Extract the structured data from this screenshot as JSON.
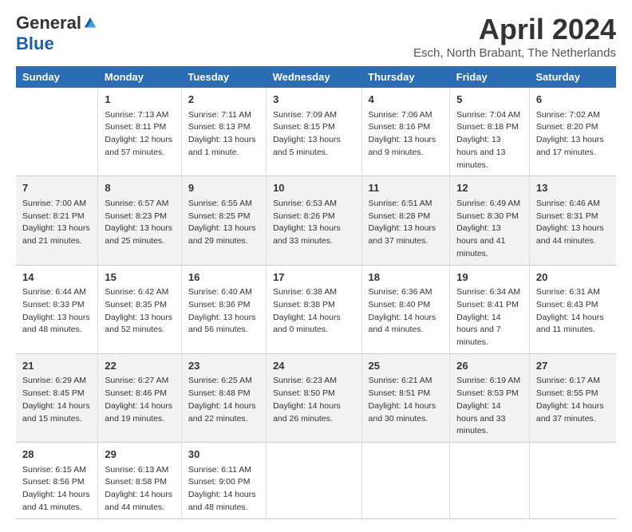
{
  "logo": {
    "general": "General",
    "blue": "Blue"
  },
  "title": "April 2024",
  "subtitle": "Esch, North Brabant, The Netherlands",
  "days_of_week": [
    "Sunday",
    "Monday",
    "Tuesday",
    "Wednesday",
    "Thursday",
    "Friday",
    "Saturday"
  ],
  "weeks": [
    [
      {
        "num": "",
        "sunrise": "",
        "sunset": "",
        "daylight": "",
        "empty": true
      },
      {
        "num": "1",
        "sunrise": "Sunrise: 7:13 AM",
        "sunset": "Sunset: 8:11 PM",
        "daylight": "Daylight: 12 hours and 57 minutes."
      },
      {
        "num": "2",
        "sunrise": "Sunrise: 7:11 AM",
        "sunset": "Sunset: 8:13 PM",
        "daylight": "Daylight: 13 hours and 1 minute."
      },
      {
        "num": "3",
        "sunrise": "Sunrise: 7:09 AM",
        "sunset": "Sunset: 8:15 PM",
        "daylight": "Daylight: 13 hours and 5 minutes."
      },
      {
        "num": "4",
        "sunrise": "Sunrise: 7:06 AM",
        "sunset": "Sunset: 8:16 PM",
        "daylight": "Daylight: 13 hours and 9 minutes."
      },
      {
        "num": "5",
        "sunrise": "Sunrise: 7:04 AM",
        "sunset": "Sunset: 8:18 PM",
        "daylight": "Daylight: 13 hours and 13 minutes."
      },
      {
        "num": "6",
        "sunrise": "Sunrise: 7:02 AM",
        "sunset": "Sunset: 8:20 PM",
        "daylight": "Daylight: 13 hours and 17 minutes."
      }
    ],
    [
      {
        "num": "7",
        "sunrise": "Sunrise: 7:00 AM",
        "sunset": "Sunset: 8:21 PM",
        "daylight": "Daylight: 13 hours and 21 minutes."
      },
      {
        "num": "8",
        "sunrise": "Sunrise: 6:57 AM",
        "sunset": "Sunset: 8:23 PM",
        "daylight": "Daylight: 13 hours and 25 minutes."
      },
      {
        "num": "9",
        "sunrise": "Sunrise: 6:55 AM",
        "sunset": "Sunset: 8:25 PM",
        "daylight": "Daylight: 13 hours and 29 minutes."
      },
      {
        "num": "10",
        "sunrise": "Sunrise: 6:53 AM",
        "sunset": "Sunset: 8:26 PM",
        "daylight": "Daylight: 13 hours and 33 minutes."
      },
      {
        "num": "11",
        "sunrise": "Sunrise: 6:51 AM",
        "sunset": "Sunset: 8:28 PM",
        "daylight": "Daylight: 13 hours and 37 minutes."
      },
      {
        "num": "12",
        "sunrise": "Sunrise: 6:49 AM",
        "sunset": "Sunset: 8:30 PM",
        "daylight": "Daylight: 13 hours and 41 minutes."
      },
      {
        "num": "13",
        "sunrise": "Sunrise: 6:46 AM",
        "sunset": "Sunset: 8:31 PM",
        "daylight": "Daylight: 13 hours and 44 minutes."
      }
    ],
    [
      {
        "num": "14",
        "sunrise": "Sunrise: 6:44 AM",
        "sunset": "Sunset: 8:33 PM",
        "daylight": "Daylight: 13 hours and 48 minutes."
      },
      {
        "num": "15",
        "sunrise": "Sunrise: 6:42 AM",
        "sunset": "Sunset: 8:35 PM",
        "daylight": "Daylight: 13 hours and 52 minutes."
      },
      {
        "num": "16",
        "sunrise": "Sunrise: 6:40 AM",
        "sunset": "Sunset: 8:36 PM",
        "daylight": "Daylight: 13 hours and 56 minutes."
      },
      {
        "num": "17",
        "sunrise": "Sunrise: 6:38 AM",
        "sunset": "Sunset: 8:38 PM",
        "daylight": "Daylight: 14 hours and 0 minutes."
      },
      {
        "num": "18",
        "sunrise": "Sunrise: 6:36 AM",
        "sunset": "Sunset: 8:40 PM",
        "daylight": "Daylight: 14 hours and 4 minutes."
      },
      {
        "num": "19",
        "sunrise": "Sunrise: 6:34 AM",
        "sunset": "Sunset: 8:41 PM",
        "daylight": "Daylight: 14 hours and 7 minutes."
      },
      {
        "num": "20",
        "sunrise": "Sunrise: 6:31 AM",
        "sunset": "Sunset: 8:43 PM",
        "daylight": "Daylight: 14 hours and 11 minutes."
      }
    ],
    [
      {
        "num": "21",
        "sunrise": "Sunrise: 6:29 AM",
        "sunset": "Sunset: 8:45 PM",
        "daylight": "Daylight: 14 hours and 15 minutes."
      },
      {
        "num": "22",
        "sunrise": "Sunrise: 6:27 AM",
        "sunset": "Sunset: 8:46 PM",
        "daylight": "Daylight: 14 hours and 19 minutes."
      },
      {
        "num": "23",
        "sunrise": "Sunrise: 6:25 AM",
        "sunset": "Sunset: 8:48 PM",
        "daylight": "Daylight: 14 hours and 22 minutes."
      },
      {
        "num": "24",
        "sunrise": "Sunrise: 6:23 AM",
        "sunset": "Sunset: 8:50 PM",
        "daylight": "Daylight: 14 hours and 26 minutes."
      },
      {
        "num": "25",
        "sunrise": "Sunrise: 6:21 AM",
        "sunset": "Sunset: 8:51 PM",
        "daylight": "Daylight: 14 hours and 30 minutes."
      },
      {
        "num": "26",
        "sunrise": "Sunrise: 6:19 AM",
        "sunset": "Sunset: 8:53 PM",
        "daylight": "Daylight: 14 hours and 33 minutes."
      },
      {
        "num": "27",
        "sunrise": "Sunrise: 6:17 AM",
        "sunset": "Sunset: 8:55 PM",
        "daylight": "Daylight: 14 hours and 37 minutes."
      }
    ],
    [
      {
        "num": "28",
        "sunrise": "Sunrise: 6:15 AM",
        "sunset": "Sunset: 8:56 PM",
        "daylight": "Daylight: 14 hours and 41 minutes."
      },
      {
        "num": "29",
        "sunrise": "Sunrise: 6:13 AM",
        "sunset": "Sunset: 8:58 PM",
        "daylight": "Daylight: 14 hours and 44 minutes."
      },
      {
        "num": "30",
        "sunrise": "Sunrise: 6:11 AM",
        "sunset": "Sunset: 9:00 PM",
        "daylight": "Daylight: 14 hours and 48 minutes."
      },
      {
        "num": "",
        "sunrise": "",
        "sunset": "",
        "daylight": "",
        "empty": true
      },
      {
        "num": "",
        "sunrise": "",
        "sunset": "",
        "daylight": "",
        "empty": true
      },
      {
        "num": "",
        "sunrise": "",
        "sunset": "",
        "daylight": "",
        "empty": true
      },
      {
        "num": "",
        "sunrise": "",
        "sunset": "",
        "daylight": "",
        "empty": true
      }
    ]
  ]
}
